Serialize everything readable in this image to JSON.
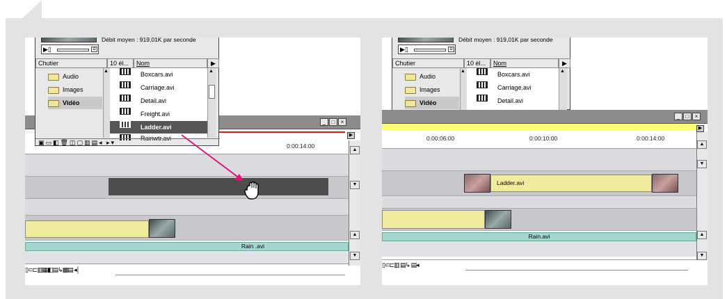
{
  "left": {
    "bin": {
      "info_text": "Débit moyen : 919,01K par seconde",
      "folder_header": "Chutier",
      "count_header": "10 él...",
      "name_header": "Nom",
      "folders": [
        "Audio",
        "Images",
        "Vidéo"
      ],
      "files": [
        "Boxcars.avi",
        "Carriage.avi",
        "Detail.avi",
        "Freight.avi",
        "Ladder.avi",
        "Rainwtr.avi"
      ]
    },
    "timeline": {
      "timecode": "0:00:14:00",
      "clip_label": "Rain .avi"
    }
  },
  "right": {
    "bin": {
      "info_text": "Débit moyen : 919,01K par seconde",
      "folder_header": "Chutier",
      "count_header": "10 él...",
      "name_header": "Nom",
      "folders": [
        "Audio",
        "Images",
        "Vidéo"
      ],
      "files": [
        "Boxcars.avi",
        "Carriage.avi",
        "Detail.avi"
      ]
    },
    "timeline": {
      "timecodes": [
        "0:00:06:00",
        "0:00:10:00",
        "0:00:14:00"
      ],
      "ladder_label": "Ladder.avi",
      "clip_label": "Rain.avi"
    }
  },
  "colors": {
    "arrow": "#e0157a",
    "yellow_clip": "#f1ec9d",
    "teal_clip": "#a4d6d2",
    "selection": "#555555"
  },
  "icons": [
    "hand-cursor-icon",
    "film-icon",
    "folder-icon",
    "minimize-icon",
    "maximize-icon",
    "close-icon"
  ]
}
